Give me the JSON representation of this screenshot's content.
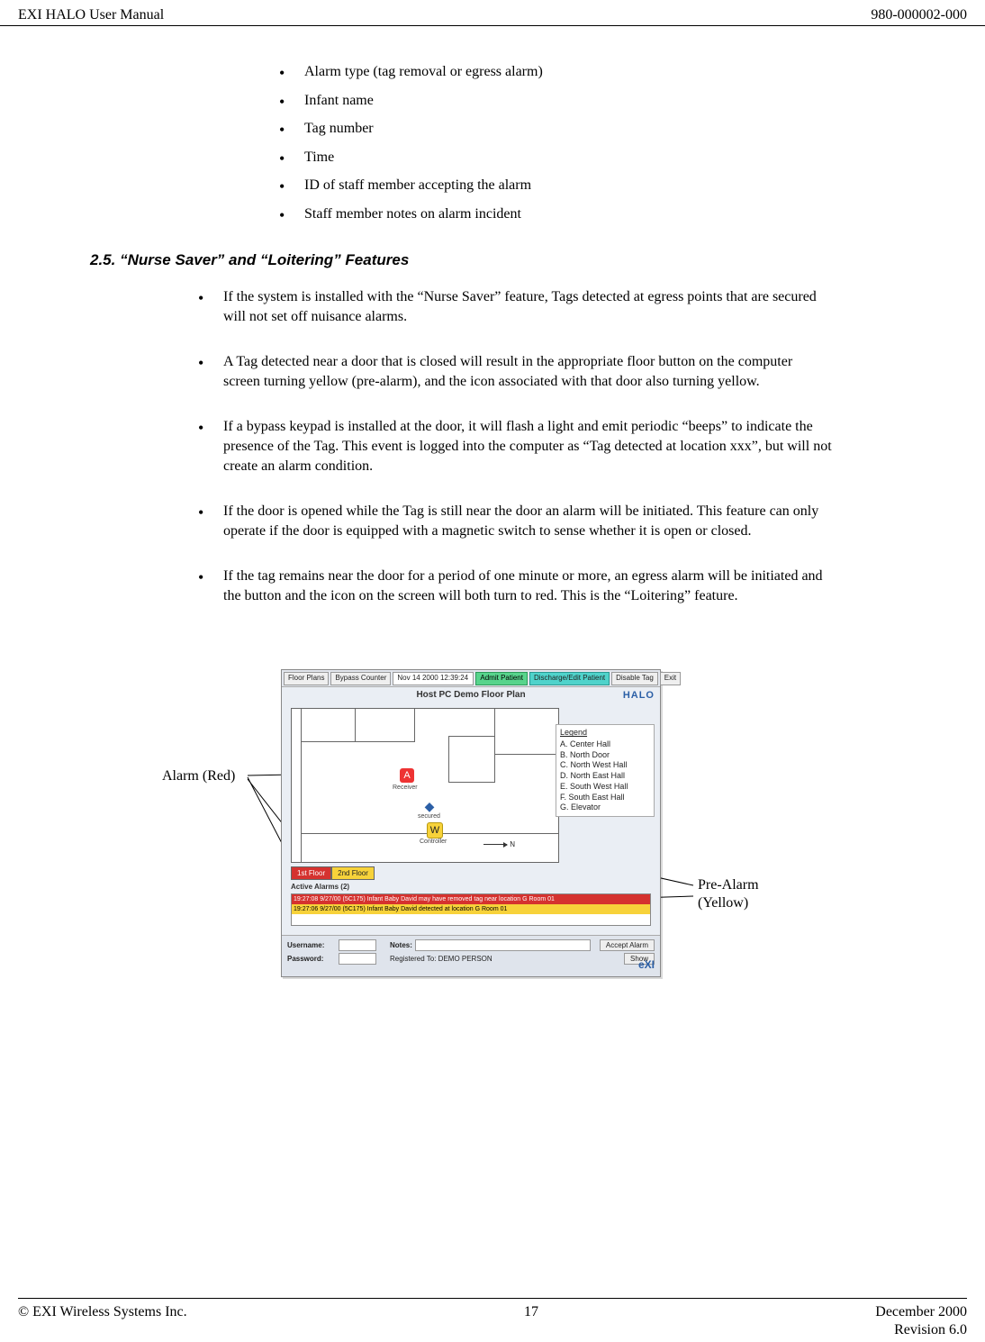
{
  "header": {
    "left": "EXI HALO User Manual",
    "right": "980-000002-000"
  },
  "intro_list": [
    "Alarm type (tag removal or egress alarm)",
    "Infant name",
    "Tag number",
    "Time",
    "ID of staff member accepting the alarm",
    "Staff member notes on alarm incident"
  ],
  "section_title": "2.5.   “Nurse Saver” and “Loitering” Features",
  "feature_list": [
    "If the system is installed with the “Nurse Saver” feature, Tags detected at egress points that are secured will not set off nuisance alarms.",
    "A Tag detected near a door that is closed will result in the appropriate floor button on the computer screen turning yellow (pre-alarm), and the icon associated with that door also turning yellow.",
    "If a bypass keypad is installed at the door, it will flash a light and emit periodic “beeps” to indicate the presence of the Tag.  This event is logged into the computer as “Tag detected at location xxx”, but will not create an alarm condition.",
    "If the door is opened while the Tag is still near the door an alarm will be initiated. This feature can only operate if the door is equipped with a magnetic switch to sense whether it is open or closed.",
    "If the tag remains near the door for a period of one minute or more, an egress alarm will be initiated and the button and the icon on the screen will both turn to red.  This is the “Loitering” feature."
  ],
  "figure": {
    "label_left": "Alarm (Red)",
    "label_right_1": "Pre-Alarm",
    "label_right_2": "(Yellow)",
    "topbar": {
      "floor_button": "Floor Plans",
      "bypass_button": "Bypass Counter",
      "time": "Nov 14 2000  12:39:24",
      "admit_button": "Admit Patient",
      "discharge_button": "Discharge/Edit Patient",
      "disable_button": "Disable Tag",
      "exit_button": "Exit"
    },
    "panel_title": "Host PC Demo Floor Plan",
    "brand": "HALO",
    "icons": {
      "red_label": "Receiver",
      "blue_label": "secured",
      "yellow_label": "Controller"
    },
    "north_label": "N",
    "legend": {
      "title": "Legend",
      "items": [
        "A.  Center Hall",
        "B.  North Door",
        "C.  North West Hall",
        "D.  North East Hall",
        "E.  South West Hall",
        "F.  South East Hall",
        "G.  Elevator"
      ]
    },
    "floor_buttons": {
      "first": "1st Floor",
      "second": "2nd Floor"
    },
    "alarms_title": "Active Alarms (2)",
    "alarm_lines": [
      "19:27:08   9/27/00    (5C175) Infant Baby David may have removed tag near location G   Room 01",
      "19:27:06   9/27/00    (5C175) Infant Baby David detected at location G   Room 01"
    ],
    "bottombar": {
      "username_label": "Username:",
      "password_label": "Password:",
      "notes_label": "Notes:",
      "registered": "Registered To:  DEMO PERSON",
      "accept_button": "Accept Alarm",
      "show_button": "Show"
    },
    "bottom_brand": "eXI"
  },
  "footer": {
    "left": "© EXI Wireless Systems Inc.",
    "center": "17",
    "right1": "December 2000",
    "right2": "Revision 6.0"
  }
}
